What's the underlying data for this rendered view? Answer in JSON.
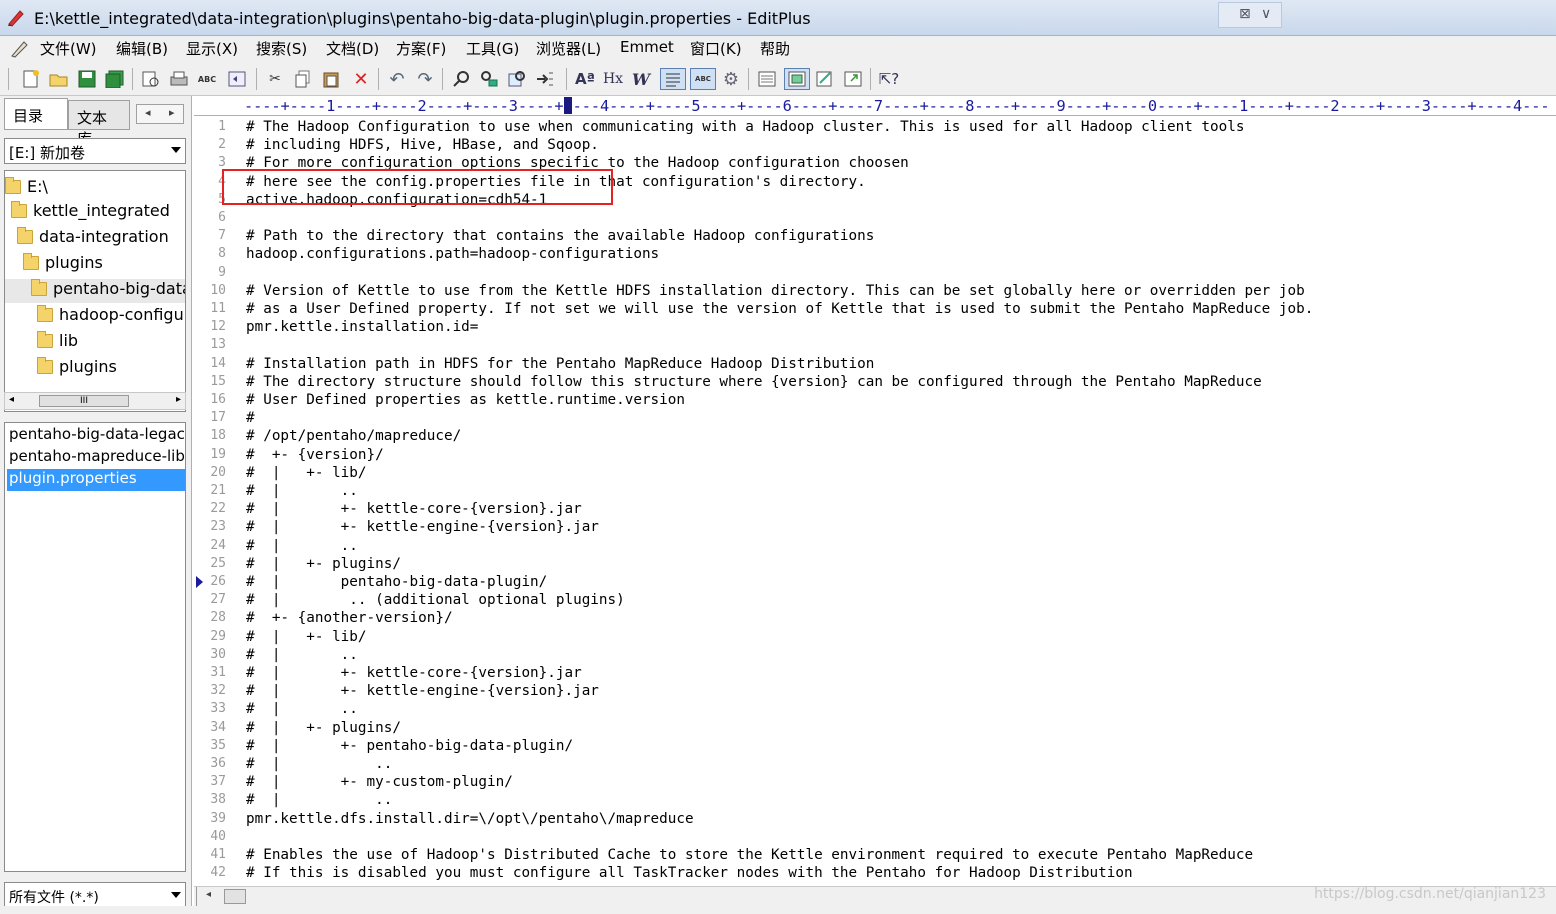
{
  "window": {
    "title": "E:\\kettle_integrated\\data-integration\\plugins\\pentaho-big-data-plugin\\plugin.properties - EditPlus",
    "controls": [
      "⊠",
      "∨"
    ]
  },
  "menu": [
    "文件(W)",
    "编辑(B)",
    "显示(X)",
    "搜索(S)",
    "文档(D)",
    "方案(F)",
    "工具(G)",
    "浏览器(L)",
    "Emmet",
    "窗口(K)",
    "帮助"
  ],
  "toolbar": {
    "icons": [
      "new-file-icon",
      "open-folder-icon",
      "save-icon",
      "save-all-icon",
      "print-preview-icon",
      "print-icon",
      "spellcheck-icon",
      "browser-icon",
      "cut-icon",
      "copy-icon",
      "paste-icon",
      "delete-icon",
      "undo-icon",
      "redo-icon",
      "find-icon",
      "replace-icon",
      "find-in-files-icon",
      "goto-line-icon",
      "font-icon",
      "hex-icon",
      "word-wrap-icon",
      "line-list-icon",
      "column-select-icon",
      "settings-icon",
      "view-icon",
      "screen-icon",
      "cliptext-icon",
      "fullscreen-icon",
      "help-icon"
    ],
    "labels": {
      "font": "Aª",
      "hex": "Hx",
      "wrap": "W",
      "abc": "ABC",
      "spell": "ABC"
    }
  },
  "sidebar": {
    "tabs": [
      "目录",
      "文本库"
    ],
    "arrows": [
      "◂",
      "▸"
    ],
    "drive": "[E:] 新加卷",
    "tree": [
      "E:\\",
      "kettle_integrated",
      "data-integration",
      "plugins",
      "pentaho-big-data",
      "hadoop-configu",
      "lib",
      "plugins"
    ],
    "tree_scroll_thumb": "III",
    "tree_scroll_arrows": [
      "◂",
      "▸"
    ],
    "files": [
      "pentaho-big-data-legacy",
      "pentaho-mapreduce-lib",
      "plugin.properties"
    ],
    "selected_file": "plugin.properties",
    "filter": "所有文件 (*.*)"
  },
  "editor": {
    "ruler": "----+----1----+----2----+----3----+----4----+----5----+----6----+----7----+----8----+----9----+----0----+----1----+----2----+----3----+----4---",
    "lines": [
      "# The Hadoop Configuration to use when communicating with a Hadoop cluster. This is used for all Hadoop client tools",
      "# including HDFS, Hive, HBase, and Sqoop.",
      "# For more configuration options specific to the Hadoop configuration choosen",
      "# here see the config.properties file in that configuration's directory.",
      "active.hadoop.configuration=cdh54-1",
      "",
      "# Path to the directory that contains the available Hadoop configurations",
      "hadoop.configurations.path=hadoop-configurations",
      "",
      "# Version of Kettle to use from the Kettle HDFS installation directory. This can be set globally here or overridden per job",
      "# as a User Defined property. If not set we will use the version of Kettle that is used to submit the Pentaho MapReduce job.",
      "pmr.kettle.installation.id=",
      "",
      "# Installation path in HDFS for the Pentaho MapReduce Hadoop Distribution",
      "# The directory structure should follow this structure where {version} can be configured through the Pentaho MapReduce",
      "# User Defined properties as kettle.runtime.version",
      "#",
      "# /opt/pentaho/mapreduce/",
      "#  +- {version}/",
      "#  |   +- lib/",
      "#  |       ..",
      "#  |       +- kettle-core-{version}.jar",
      "#  |       +- kettle-engine-{version}.jar",
      "#  |       ..",
      "#  |   +- plugins/",
      "#  |       pentaho-big-data-plugin/",
      "#  |        .. (additional optional plugins)",
      "#  +- {another-version}/",
      "#  |   +- lib/",
      "#  |       ..",
      "#  |       +- kettle-core-{version}.jar",
      "#  |       +- kettle-engine-{version}.jar",
      "#  |       ..",
      "#  |   +- plugins/",
      "#  |       +- pentaho-big-data-plugin/",
      "#  |           ..",
      "#  |       +- my-custom-plugin/",
      "#  |           ..",
      "pmr.kettle.dfs.install.dir=\\/opt\\/pentaho\\/mapreduce",
      "",
      "# Enables the use of Hadoop's Distributed Cache to store the Kettle environment required to execute Pentaho MapReduce",
      "# If this is disabled you must configure all TaskTracker nodes with the Pentaho for Hadoop Distribution"
    ],
    "line_numbers": [
      "1",
      "2",
      "3",
      "4",
      "5",
      "6",
      "7",
      "8",
      "9",
      "10",
      "11",
      "12",
      "13",
      "14",
      "15",
      "16",
      "17",
      "18",
      "19",
      "20",
      "21",
      "22",
      "23",
      "24",
      "25",
      "26",
      "27",
      "28",
      "29",
      "30",
      "31",
      "32",
      "33",
      "34",
      "35",
      "36",
      "37",
      "38",
      "39",
      "40",
      "41",
      "42"
    ],
    "bookmark_line": 26,
    "highlight": "active.hadoop.configuration=cdh54-1",
    "highlight_color": "#e52222"
  },
  "scrollbar": {
    "left_arrow": "◂"
  },
  "watermark": "https://blog.csdn.net/qianjian123"
}
